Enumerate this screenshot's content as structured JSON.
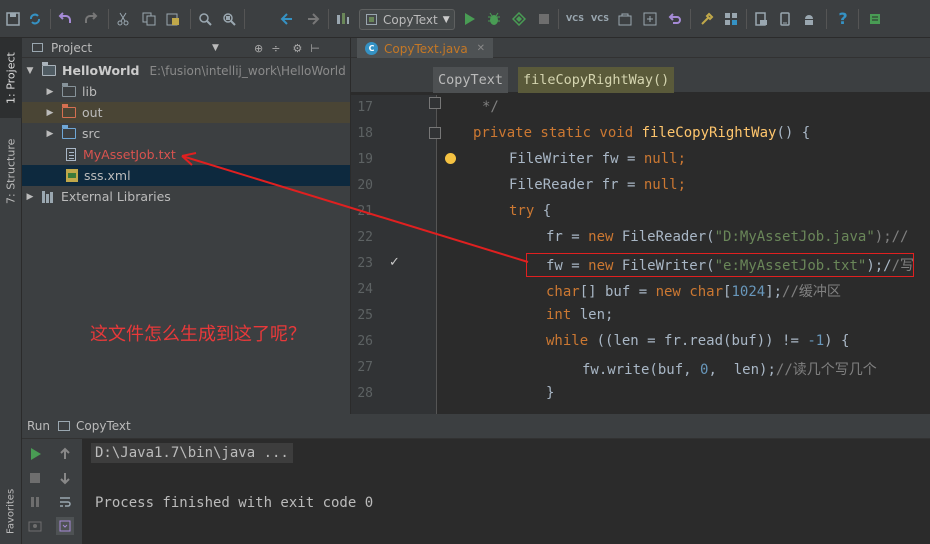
{
  "toolbar": {
    "run_config": "CopyText",
    "vcs_label_1": "VCS",
    "vcs_label_2": "VCS",
    "help": "?"
  },
  "stripe": {
    "project_tab": "1: Project",
    "structure_tab": "7: Structure",
    "favorites_tab": "Favorites"
  },
  "project_panel": {
    "header": "Project",
    "tree": [
      {
        "label": "HelloWorld",
        "path": "E:\\fusion\\intellij_work\\HelloWorld"
      },
      {
        "label": "lib"
      },
      {
        "label": "out"
      },
      {
        "label": "src"
      },
      {
        "label": "MyAssetJob.txt"
      },
      {
        "label": "sss.xml"
      },
      {
        "label": "External Libraries"
      }
    ]
  },
  "editor": {
    "tab_label": "CopyText.java",
    "breadcrumbs": [
      "CopyText",
      "fileCopyRightWay()"
    ],
    "line_numbers": [
      "17",
      "18",
      "19",
      "20",
      "21",
      "22",
      "23",
      "24",
      "25",
      "26",
      "27",
      "28"
    ],
    "code": {
      "l17": "*/",
      "l18_kw": "private static void ",
      "l18_fn": "fileCopyRightWay",
      "l18_rest": "() {",
      "l19_a": "FileWriter fw = ",
      "l19_kw": "null",
      "l19_b": ";",
      "l20_a": "FileReader fr = ",
      "l20_kw": "null",
      "l20_b": ";",
      "l21_kw": "try",
      "l21_b": " {",
      "l22_a": "fr = ",
      "l22_kw": "new",
      "l22_b": " FileReader(",
      "l22_str": "\"D:MyAssetJob.java\"",
      "l22_c": ");//",
      "l23_a": "fw = ",
      "l23_kw": "new",
      "l23_b": " FileWriter(",
      "l23_str": "\"e:MyAssetJob.txt\"",
      "l23_c": ");/",
      "l23_cm": "/写",
      "l24_kw": "char",
      "l24_a": "[] buf = ",
      "l24_kw2": "new",
      "l24_b": " ",
      "l24_kw3": "char",
      "l24_c": "[",
      "l24_num": "1024",
      "l24_d": "];",
      "l24_cm": "//缓冲区",
      "l25_kw": "int",
      "l25_a": " len;",
      "l26_kw": "while",
      "l26_a": " ((len = fr.read(buf)) != ",
      "l26_num": "-1",
      "l26_b": ") {",
      "l27_a": "fw.write(buf, ",
      "l27_num1": "0",
      "l27_b": ",  len);",
      "l27_cm": "//读几个写几个",
      "l28": "}"
    }
  },
  "annotation": {
    "question": "这文件怎么生成到这了呢？"
  },
  "run_panel": {
    "label": "Run",
    "config": "CopyText",
    "console_lines": [
      "D:\\Java1.7\\bin\\java ...",
      "Process finished with exit code 0"
    ]
  },
  "colors": {
    "annotation": "#e02020",
    "keyword": "#cc7832",
    "string": "#6a8759",
    "number": "#6897bb"
  }
}
